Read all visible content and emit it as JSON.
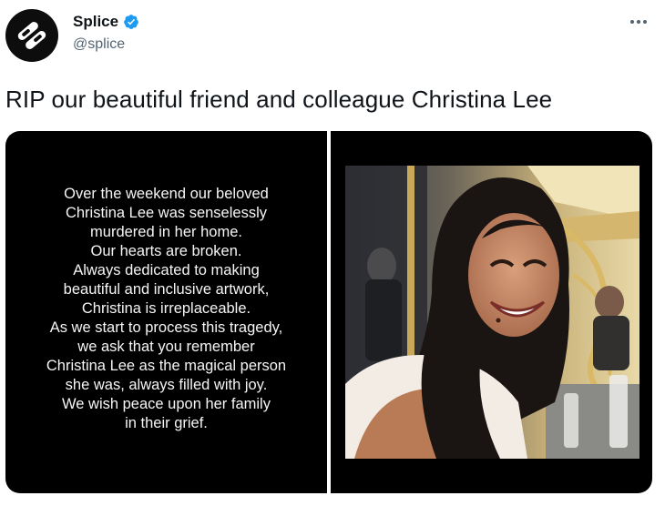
{
  "account": {
    "display_name": "Splice",
    "handle": "@splice",
    "avatar_icon": "splice-logo-icon",
    "verified_icon": "verified-badge-icon",
    "verified_color": "#1d9bf0"
  },
  "menu": {
    "more_icon": "more-options-icon"
  },
  "tweet": {
    "text": "RIP our beautiful friend and colleague Christina Lee"
  },
  "media": {
    "statement_lines": [
      "Over the weekend our beloved",
      "Christina Lee was senselessly",
      "murdered in her home.",
      "Our hearts are broken.",
      "Always dedicated to making",
      "beautiful and inclusive artwork,",
      "Christina is irreplaceable.",
      "As we start to process this tragedy,",
      "we ask that you remember",
      "Christina Lee as the magical person",
      "she was, always filled with joy.",
      "We wish peace upon her family",
      "in their grief."
    ]
  }
}
